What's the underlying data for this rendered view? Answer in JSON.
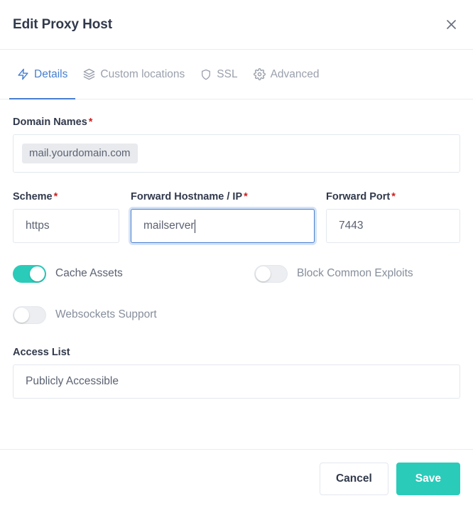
{
  "header": {
    "title": "Edit Proxy Host",
    "close_icon": "close-icon"
  },
  "tabs": [
    {
      "label": "Details",
      "icon": "bolt-icon",
      "active": true
    },
    {
      "label": "Custom locations",
      "icon": "layers-icon",
      "active": false
    },
    {
      "label": "SSL",
      "icon": "shield-icon",
      "active": false
    },
    {
      "label": "Advanced",
      "icon": "gear-icon",
      "active": false
    }
  ],
  "form": {
    "domain_names": {
      "label": "Domain Names",
      "required_marker": "*",
      "tags": [
        "mail.yourdomain.com"
      ]
    },
    "scheme": {
      "label": "Scheme",
      "required_marker": "*",
      "value": "https"
    },
    "forward_hostname": {
      "label": "Forward Hostname / IP",
      "required_marker": "*",
      "value": "mailserver",
      "focused": true
    },
    "forward_port": {
      "label": "Forward Port",
      "required_marker": "*",
      "value": "7443"
    },
    "toggles": [
      {
        "label": "Cache Assets",
        "on": true
      },
      {
        "label": "Block Common Exploits",
        "on": false
      },
      {
        "label": "Websockets Support",
        "on": false
      }
    ],
    "access_list": {
      "label": "Access List",
      "value": "Publicly Accessible"
    }
  },
  "footer": {
    "cancel_label": "Cancel",
    "save_label": "Save"
  },
  "colors": {
    "accent_teal": "#2bcbba",
    "accent_blue": "#467fcf",
    "required_red": "#cd201f",
    "text_dark": "#31394b",
    "text_muted": "#9aa0ac",
    "border": "#e3e7ed"
  }
}
